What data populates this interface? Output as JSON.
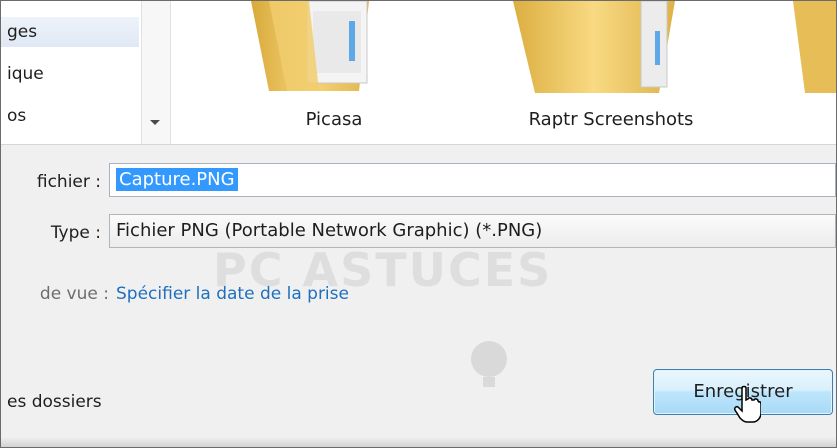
{
  "nav_pane": {
    "items": [
      {
        "label": "ges",
        "selected": true
      },
      {
        "label": "ique",
        "selected": false
      },
      {
        "label": "os",
        "selected": false
      }
    ]
  },
  "folders": [
    {
      "name": "Picasa"
    },
    {
      "name": "Raptr Screenshots"
    },
    {
      "name": ""
    }
  ],
  "form": {
    "filename_label": "fichier :",
    "filename_value": "Capture.PNG",
    "type_label": "Type :",
    "type_value": "Fichier PNG (Portable Network Graphic) (*.PNG)",
    "viewpoint_label": "de vue :",
    "viewpoint_link": "Spécifier la date de la prise",
    "hide_folders_label": "es dossiers",
    "save_button": "Enregistrer"
  },
  "watermark": {
    "text": "PC ASTUCES"
  }
}
